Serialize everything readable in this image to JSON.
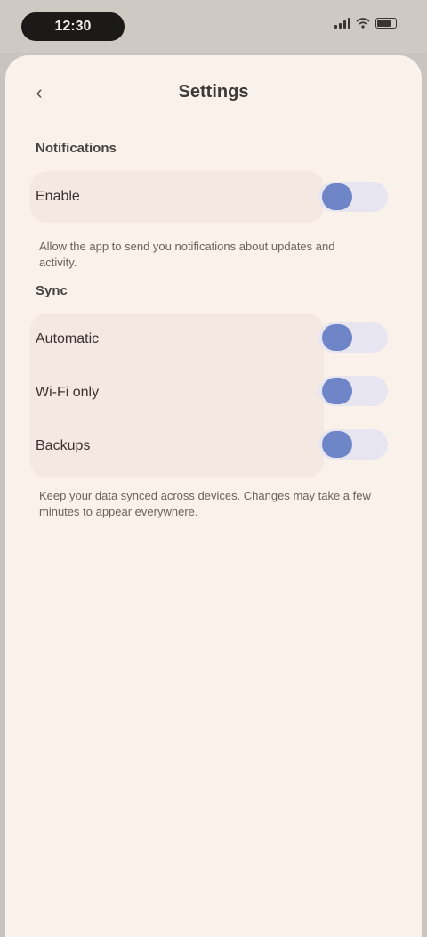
{
  "status_bar": {
    "time": "12:30"
  },
  "nav": {
    "title": "Settings"
  },
  "sections": {
    "first_header": "Notifications",
    "first_toggle_label": "Enable",
    "first_note": "Allow the app to send you notifications about updates and activity.",
    "second_header": "Sync",
    "toggles": [
      {
        "label": "Automatic",
        "state": "on"
      },
      {
        "label": "Wi-Fi only",
        "state": "on"
      },
      {
        "label": "Backups",
        "state": "on"
      }
    ],
    "second_note": "Keep your data synced across devices. Changes may take a few minutes to appear everywhere."
  },
  "colors": {
    "background": "#faf2ea",
    "group": "#f4e8e2",
    "toggle_on_knob": "#6e85c8",
    "toggle_track": "#e7e5ef"
  }
}
